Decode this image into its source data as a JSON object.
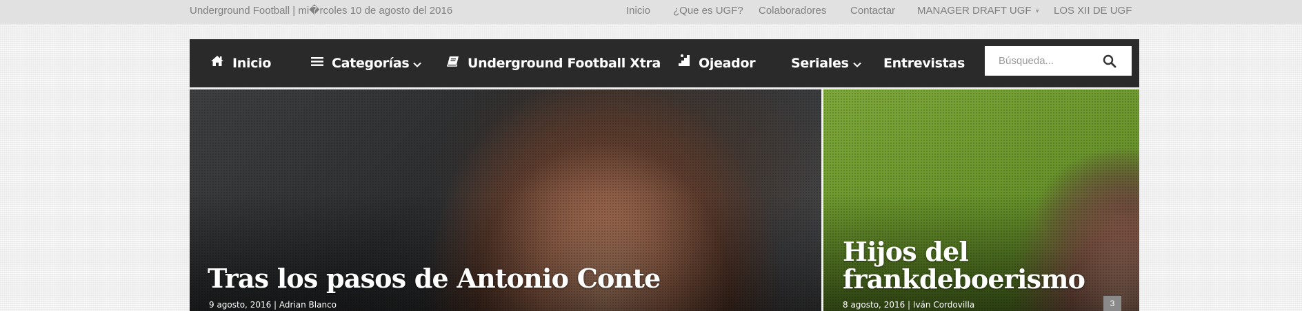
{
  "topbar": {
    "site_date": "Underground Football | mi�rcoles 10 de agosto del 2016",
    "links": [
      {
        "label": "Inicio"
      },
      {
        "label": "¿Que es UGF?"
      },
      {
        "label": "Colaboradores"
      },
      {
        "label": "Contactar"
      },
      {
        "label": "MANAGER DRAFT UGF",
        "caret": "▾"
      },
      {
        "label": "LOS XII DE UGF"
      }
    ]
  },
  "mainnav": {
    "items": [
      {
        "label": "Inicio",
        "icon": "home-icon"
      },
      {
        "label": "Categorías",
        "icon": "menu-icon",
        "dropdown": true
      },
      {
        "label": "Underground Football Xtra",
        "icon": "book-icon"
      },
      {
        "label": "Ojeador",
        "icon": "stairs-icon"
      },
      {
        "label": "Seriales",
        "dropdown": true
      },
      {
        "label": "Entrevistas"
      }
    ],
    "search": {
      "placeholder": "Búsqueda...",
      "icon": "search-icon"
    }
  },
  "featured": [
    {
      "title": "Tras los pasos de Antonio Conte",
      "meta": "9 agosto, 2016 | Adrian Blanco"
    },
    {
      "title": "Hijos del frankdeboerismo",
      "meta": "8 agosto, 2016 | Iván Cordovilla",
      "comments": "3"
    }
  ],
  "colors": {
    "topbar_bg": "#e1e1e1",
    "nav_bg": "#2a2a2a",
    "nav_text": "#ffffff",
    "topbar_text": "#7f7f7f"
  }
}
